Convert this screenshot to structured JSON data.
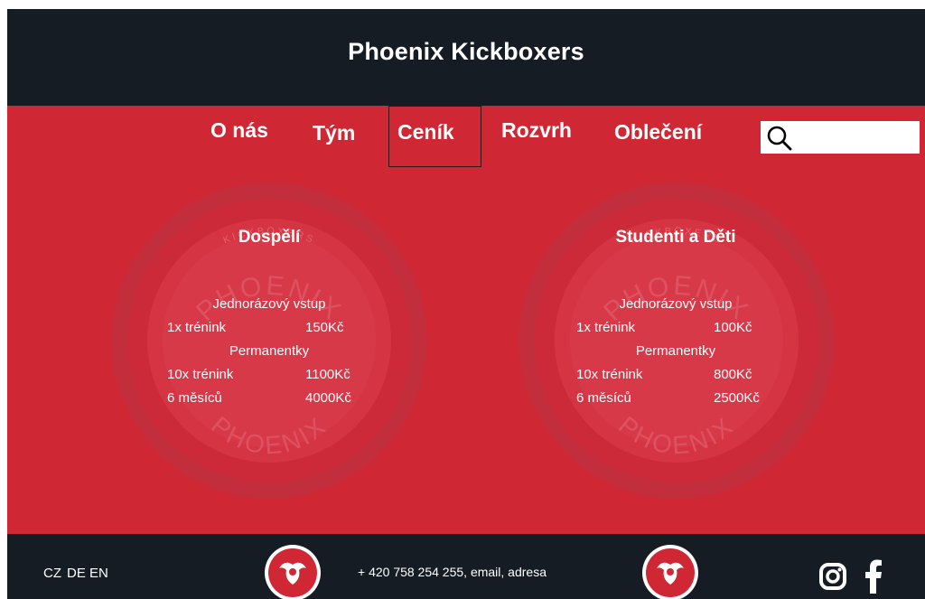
{
  "header": {
    "title": "Phoenix Kickboxers"
  },
  "nav": {
    "items": [
      {
        "label": "O nás"
      },
      {
        "label": "Tým"
      },
      {
        "label": "Ceník"
      },
      {
        "label": "Rozvrh"
      },
      {
        "label": "Oblečení"
      }
    ],
    "active": "Ceník"
  },
  "search": {
    "value": "",
    "placeholder": "",
    "icon": "search-icon"
  },
  "pricing": [
    {
      "title": "Dospělí",
      "single_heading": "Jednorázový vstup",
      "single": {
        "label": "1x trénink",
        "price": "150Kč"
      },
      "pass_heading": "Permanentky",
      "passes": [
        {
          "label": "10x trénink",
          "price": "1100Kč"
        },
        {
          "label": "6 měsíců",
          "price": "4000Kč"
        }
      ]
    },
    {
      "title": "Studenti a Děti",
      "single_heading": "Jednorázový vstup",
      "single": {
        "label": "1x trénink",
        "price": "100Kč"
      },
      "pass_heading": "Permanentky",
      "passes": [
        {
          "label": "10x trénink",
          "price": "800Kč"
        },
        {
          "label": "6 měsíců",
          "price": "2500Kč"
        }
      ]
    }
  ],
  "emblem": {
    "top_text": "KICKBOXERS",
    "arc_text": "PHOENIX",
    "bottom_text": "PHOENIX"
  },
  "footer": {
    "languages": [
      "CZ",
      "DE",
      "EN"
    ],
    "contact": "+ 420 758 254 255, email, adresa",
    "social": [
      "instagram-icon",
      "facebook-icon"
    ]
  },
  "colors": {
    "header_bg": "#151c24",
    "main_bg": "#d02735",
    "text": "#ffffff"
  }
}
